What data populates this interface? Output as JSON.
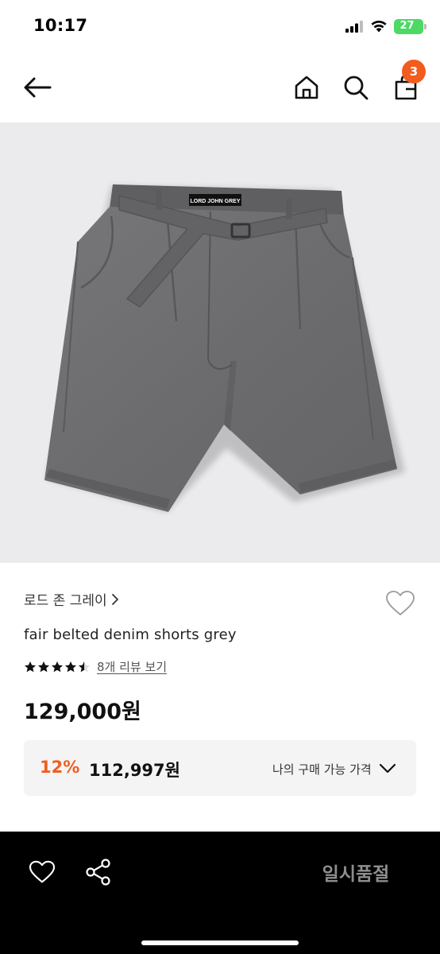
{
  "status_bar": {
    "time": "10:17",
    "battery": "27"
  },
  "header": {
    "cart_count": "3",
    "icons": [
      "back-arrow-icon",
      "home-icon",
      "search-icon",
      "shopping-bag-icon"
    ]
  },
  "product": {
    "image_label_text": "LORD JOHN GREY",
    "brand": "로드 존 그레이",
    "title": "fair belted denim shorts grey",
    "rating": 4.5,
    "review_link": "8개 리뷰 보기",
    "price": "129,000원",
    "discount": {
      "rate": "12%",
      "price": "112,997원",
      "label": "나의 구매 가능 가격"
    }
  },
  "bottom_bar": {
    "soldout_label": "일시품절"
  },
  "colors": {
    "accent": "#f25c1e",
    "image_background": "#ebebed",
    "bottom_bar": "#000000"
  }
}
